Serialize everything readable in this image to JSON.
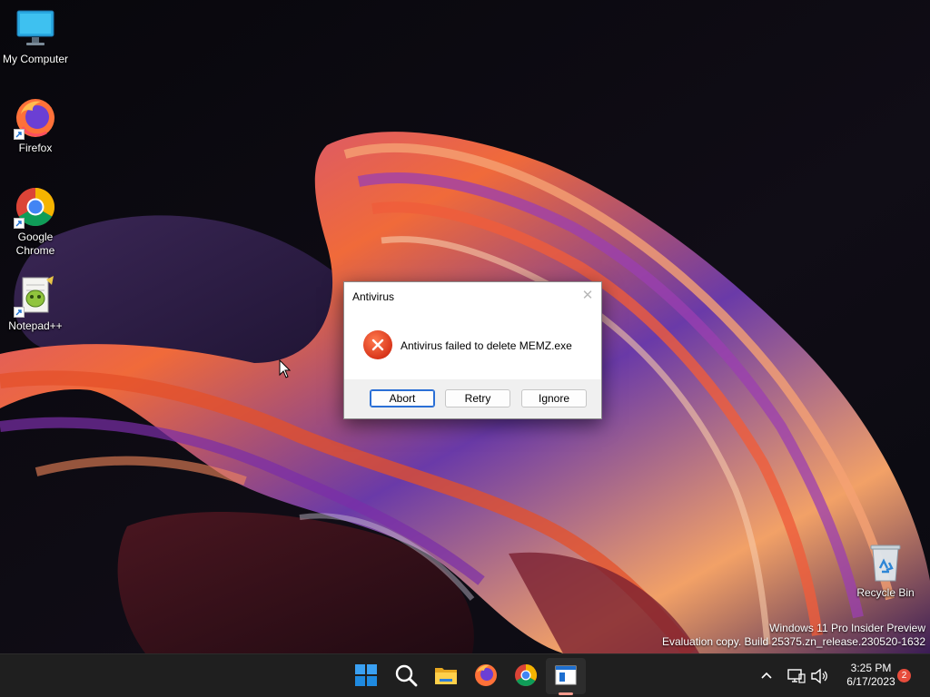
{
  "desktop": {
    "icons": [
      {
        "label": "My Computer"
      },
      {
        "label": "Firefox"
      },
      {
        "label": "Google Chrome"
      },
      {
        "label": "Notepad++"
      },
      {
        "label": "Recycle Bin"
      }
    ],
    "watermark": {
      "line1": "Windows 11 Pro Insider Preview",
      "line2": "Evaluation copy. Build 25375.zn_release.230520-1632"
    }
  },
  "dialog": {
    "title": "Antivirus",
    "close_label": "✕",
    "icon": "error-icon",
    "message": "Antivirus failed to delete MEMZ.exe",
    "buttons": {
      "abort": "Abort",
      "retry": "Retry",
      "ignore": "Ignore"
    }
  },
  "taskbar": {
    "apps": [
      "start-icon",
      "search-icon",
      "file-explorer-icon",
      "firefox-icon",
      "chrome-icon",
      "dialog-window-icon"
    ],
    "tray": {
      "time": "3:25 PM",
      "date": "6/17/2023",
      "notification_count": "2"
    }
  },
  "colors": {
    "accent": "#2a6fd6",
    "error": "#d9361b",
    "taskbar": "#1f1f1f"
  }
}
